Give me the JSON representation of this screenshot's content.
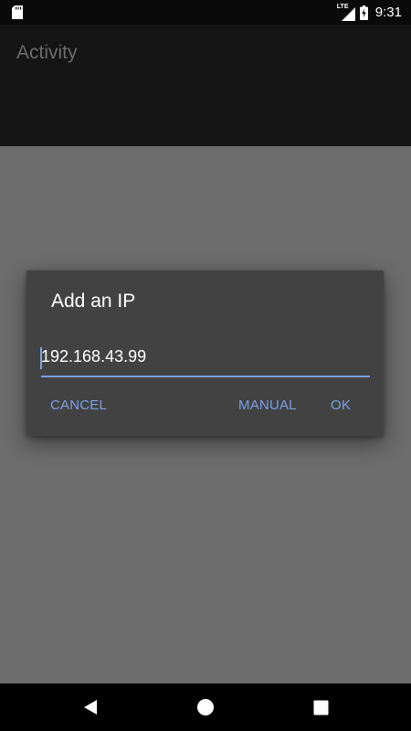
{
  "status_bar": {
    "network_label": "LTE",
    "time": "9:31",
    "icons": [
      "sd-card-icon",
      "signal-icon",
      "battery-charging-icon"
    ]
  },
  "action_bar": {
    "title": "Activity"
  },
  "dialog": {
    "title": "Add an IP",
    "ip_value": "192.168.43.99",
    "buttons": {
      "cancel": "CANCEL",
      "manual": "MANUAL",
      "ok": "OK"
    }
  },
  "nav_bar": {
    "icons": [
      "back-icon",
      "home-icon",
      "recents-icon"
    ]
  },
  "colors": {
    "accent": "#7aa0e6",
    "dialog_bg": "#424242",
    "scrim": "#6c6c6c"
  }
}
